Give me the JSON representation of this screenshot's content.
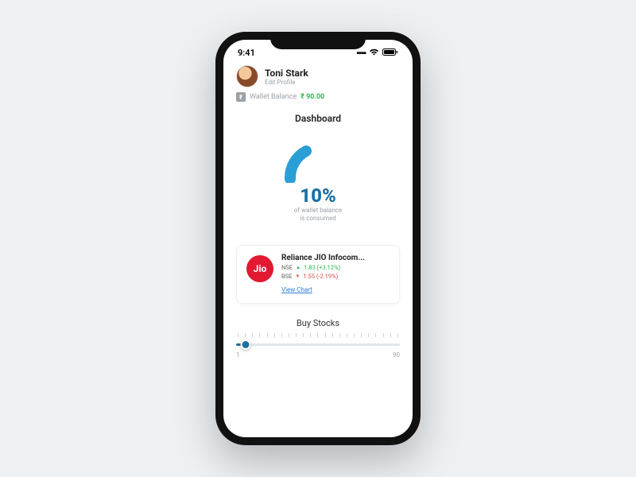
{
  "status": {
    "time": "9:41"
  },
  "profile": {
    "name": "Toni Stark",
    "edit": "Edit Profile"
  },
  "wallet": {
    "label": "Wallet Balance",
    "currency": "₹",
    "amount": "90.00"
  },
  "dashboard": {
    "title": "Dashboard",
    "percent": "10%",
    "sub1": "of wallet balance",
    "sub2": "is consumed"
  },
  "stock": {
    "logo_text": "Jio",
    "name": "Reliance JIO Infocom...",
    "nse_label": "NSE",
    "nse_value": "1.83 (+3.12%)",
    "bse_label": "BSE",
    "bse_value": "1.55 (-2.19%)",
    "view_chart": "View Chart"
  },
  "buy": {
    "title": "Buy Stocks",
    "min": "1",
    "max": "90"
  },
  "chart_data": {
    "type": "gauge",
    "value": 10,
    "max": 100,
    "unit": "%",
    "label": "of wallet balance is consumed"
  }
}
